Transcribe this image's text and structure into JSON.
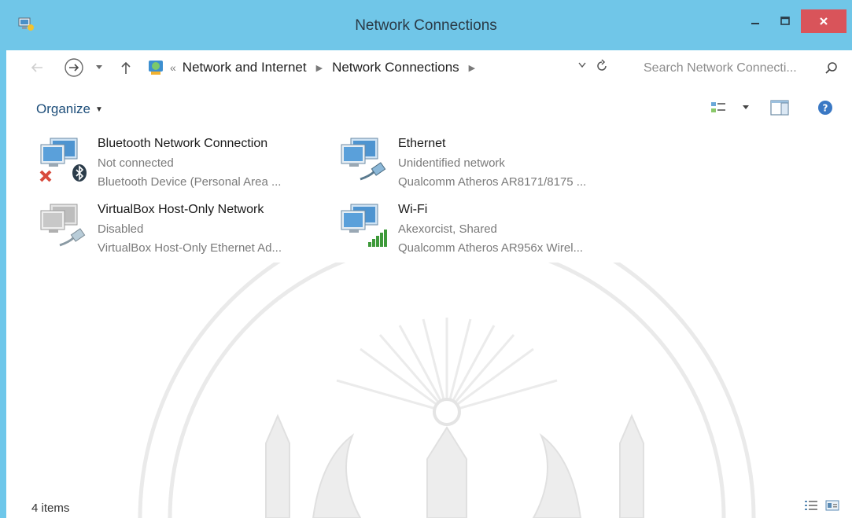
{
  "window": {
    "title": "Network Connections",
    "accent_color": "#70c6e8",
    "close_color": "#d9545a"
  },
  "address_bar": {
    "overflow": "«",
    "crumbs": [
      "Network and Internet",
      "Network Connections"
    ],
    "search_placeholder": "Search Network Connecti..."
  },
  "toolbar": {
    "organize_label": "Organize"
  },
  "connections": [
    {
      "name": "Bluetooth Network Connection",
      "status": "Not connected",
      "device": "Bluetooth Device (Personal Area ...",
      "icon": "bluetooth-disconnected-icon"
    },
    {
      "name": "Ethernet",
      "status": "Unidentified network",
      "device": "Qualcomm Atheros AR8171/8175 ...",
      "icon": "ethernet-cable-icon"
    },
    {
      "name": "VirtualBox Host-Only Network",
      "status": "Disabled",
      "device": "VirtualBox Host-Only Ethernet Ad...",
      "icon": "ethernet-disabled-icon"
    },
    {
      "name": "Wi-Fi",
      "status": "Akexorcist, Shared",
      "device": "Qualcomm Atheros AR956x Wirel...",
      "icon": "wifi-signal-icon"
    }
  ],
  "status_bar": {
    "item_count": "4 items"
  }
}
